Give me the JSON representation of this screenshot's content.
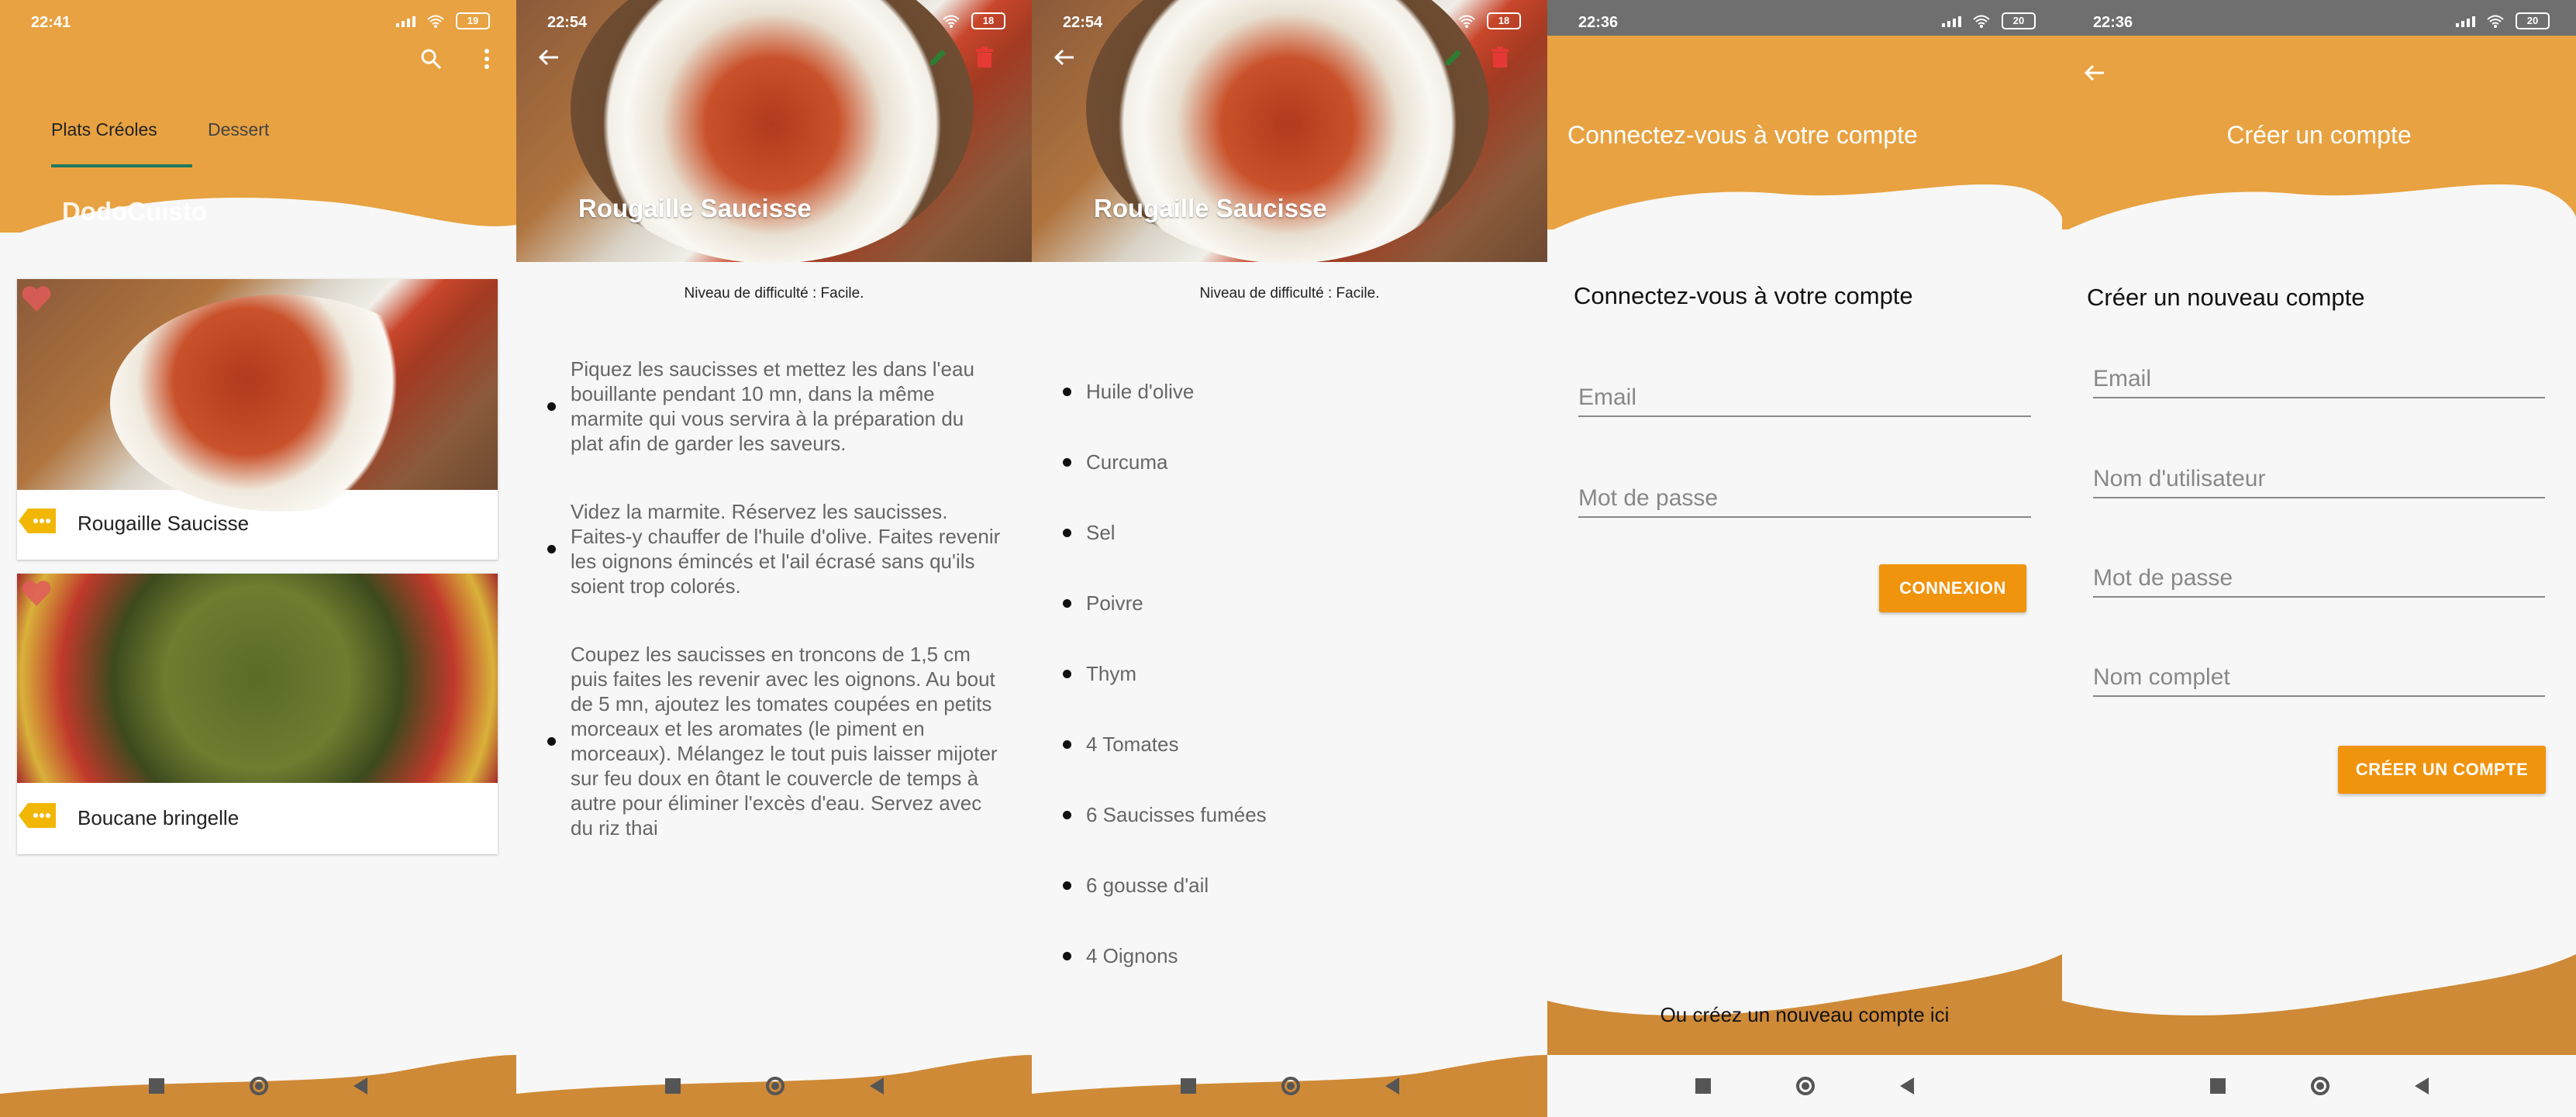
{
  "colors": {
    "accent": "#e8a241",
    "button": "#f0930d",
    "navbar_wave": "#cf8a37"
  },
  "screen1": {
    "status": {
      "time": "22:41",
      "battery": "19"
    },
    "tabs": [
      {
        "label": "Plats Créoles"
      },
      {
        "label": "Dessert"
      }
    ],
    "app_title": "DodoCuisto",
    "cards": [
      {
        "title": "Rougaille Saucisse"
      },
      {
        "title": "Boucane bringelle"
      }
    ]
  },
  "screen2": {
    "status": {
      "time": "22:54",
      "battery": "18"
    },
    "title": "Rougaille Saucisse",
    "difficulty": "Niveau de difficulté : Facile.",
    "steps": [
      "Piquez les saucisses et mettez les dans l'eau bouillante pendant 10 mn, dans la même marmite qui vous servira à la préparation du plat afin de garder les saveurs.",
      "Videz la marmite. Réservez les saucisses. Faites-y chauffer de l'huile d'olive. Faites revenir les oignons émincés et l'ail écrasé sans qu'ils soient trop colorés.",
      "Coupez les saucisses en troncons de 1,5 cm puis faites les revenir avec les oignons. Au bout de 5 mn, ajoutez les tomates coupées en petits morceaux et les aromates (le piment en morceaux). Mélangez le tout puis laisser mijoter sur feu doux en ôtant le couvercle de temps à autre pour éliminer l'excès d'eau. Servez avec du riz thai"
    ]
  },
  "screen3": {
    "status": {
      "time": "22:54",
      "battery": "18"
    },
    "title": "Rougaille Saucisse",
    "difficulty": "Niveau de difficulté : Facile.",
    "ingredients": [
      "Huile d'olive",
      "Curcuma",
      "Sel",
      "Poivre",
      "Thym",
      "4 Tomates",
      "6 Saucisses fumées",
      "6 gousse d'ail",
      "4 Oignons"
    ]
  },
  "screen4": {
    "status": {
      "time": "22:36",
      "battery": "20"
    },
    "header": "Connectez-vous à votre compte",
    "subtitle": "Connectez-vous à votre compte",
    "email_placeholder": "Email",
    "password_placeholder": "Mot de passe",
    "login_button": "CONNEXION",
    "create_link": "Ou créez un nouveau compte ici"
  },
  "screen5": {
    "status": {
      "time": "22:36",
      "battery": "20"
    },
    "header": "Créer un compte",
    "subtitle": "Créer un nouveau compte",
    "email_placeholder": "Email",
    "username_placeholder": "Nom d'utilisateur",
    "password_placeholder": "Mot de passe",
    "fullname_placeholder": "Nom complet",
    "create_button": "CRÉER UN COMPTE"
  }
}
